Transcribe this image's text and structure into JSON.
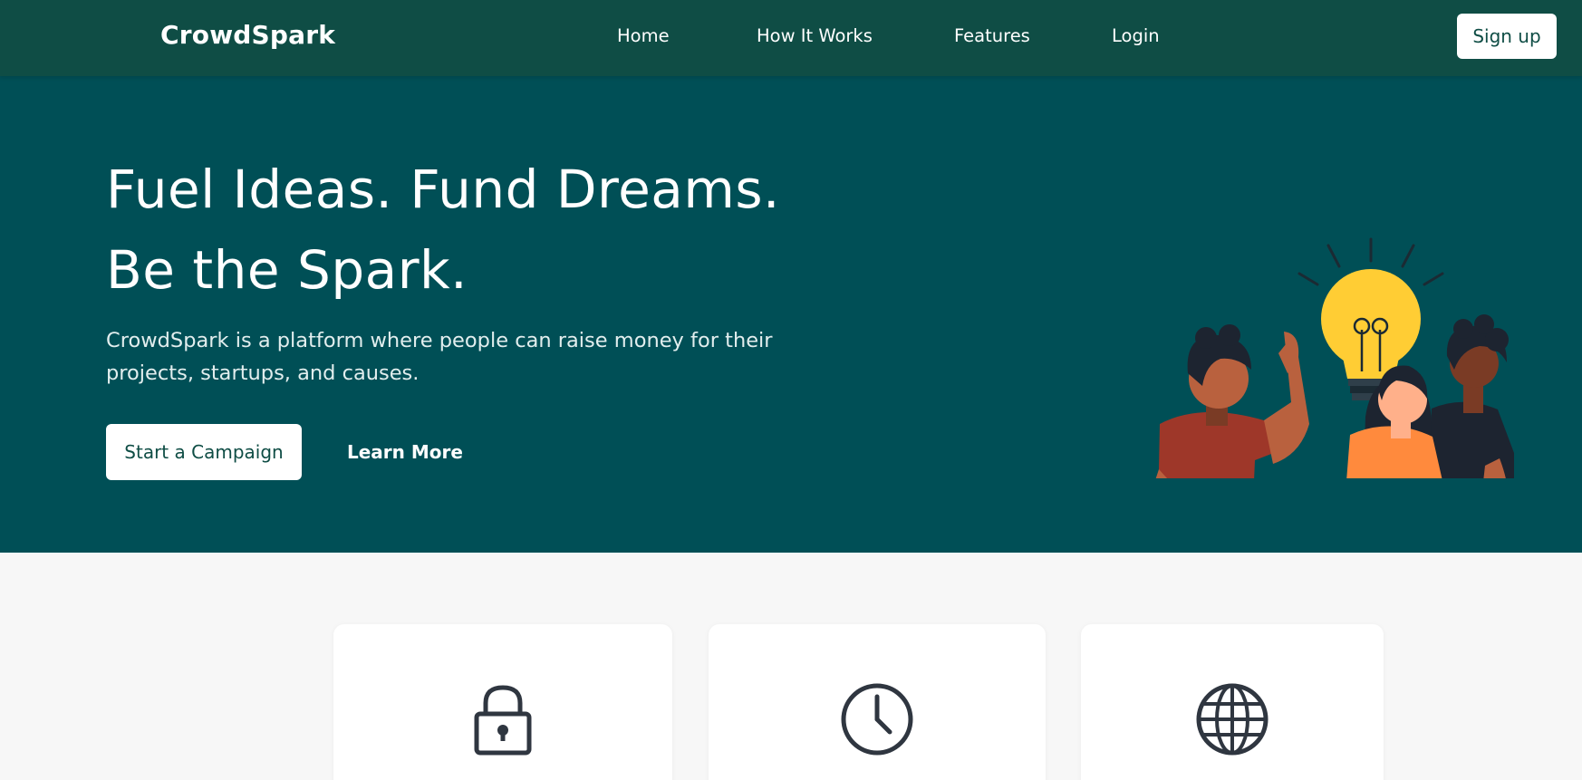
{
  "nav": {
    "brand": "CrowdSpark",
    "links": [
      "Home",
      "How It Works",
      "Features",
      "Login"
    ],
    "signup_label": "Sign up"
  },
  "hero": {
    "title_line1": "Fuel Ideas. Fund Dreams.",
    "title_line2": "Be the Spark.",
    "description": "CrowdSpark is a platform where people can raise money for their projects, startups, and causes.",
    "primary_cta": "Start a Campaign",
    "secondary_cta": "Learn More"
  },
  "features": [
    {
      "icon": "lock-icon"
    },
    {
      "icon": "clock-icon"
    },
    {
      "icon": "globe-icon"
    }
  ],
  "colors": {
    "navbar": "#0f4d45",
    "hero": "#004f56",
    "page_background": "#f7f7f7",
    "card": "#ffffff",
    "icon_stroke": "#2f3640",
    "bulb": "#ffcd34"
  }
}
